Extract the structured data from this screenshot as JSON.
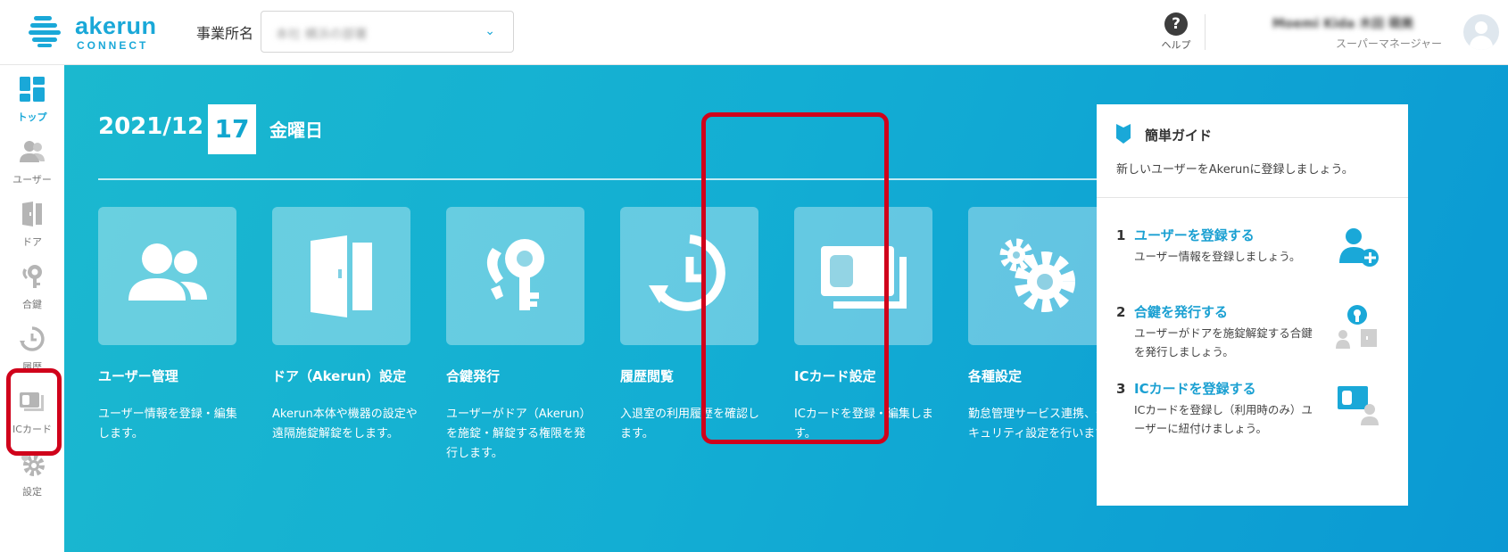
{
  "header": {
    "logo_word": "akerun",
    "logo_sub": "CONNECT",
    "office_label": "事業所名",
    "office_value": "本社 横浜の部署",
    "help_label": "ヘルプ",
    "user_name": "Moemi Kida 木田 萌美",
    "user_role": "スーパーマネージャー"
  },
  "sidebar": {
    "items": [
      {
        "label": "トップ",
        "icon": "dashboard-icon"
      },
      {
        "label": "ユーザー",
        "icon": "users-icon"
      },
      {
        "label": "ドア",
        "icon": "door-icon"
      },
      {
        "label": "合鍵",
        "icon": "key-icon"
      },
      {
        "label": "履歴",
        "icon": "history-icon"
      },
      {
        "label": "ICカード",
        "icon": "ic-card-icon"
      },
      {
        "label": "設定",
        "icon": "gear-icon"
      }
    ]
  },
  "main": {
    "date_ym": "2021/12",
    "date_day": "17",
    "date_dow": "金曜日",
    "cards": [
      {
        "title": "ユーザー管理",
        "desc": "ユーザー情報を登録・編集します。",
        "icon": "users-icon"
      },
      {
        "title": "ドア（Akerun）設定",
        "desc": "Akerun本体や機器の設定や遠隔施錠解錠をします。",
        "icon": "door-icon"
      },
      {
        "title": "合鍵発行",
        "desc": "ユーザーがドア（Akerun）を施錠・解錠する権限を発行します。",
        "icon": "key-icon"
      },
      {
        "title": "履歴閲覧",
        "desc": "入退室の利用履歴を確認します。",
        "icon": "history-icon"
      },
      {
        "title": "ICカード設定",
        "desc": "ICカードを登録・編集します。",
        "icon": "ic-card-icon"
      },
      {
        "title": "各種設定",
        "desc": "勤怠管理サービス連携、セキュリティ設定を行います。",
        "icon": "gear-icon"
      }
    ]
  },
  "guide": {
    "title": "簡単ガイド",
    "intro": "新しいユーザーをAkerunに登録しましょう。",
    "steps": [
      {
        "num": "1",
        "link": "ユーザーを登録する",
        "desc": "ユーザー情報を登録しましょう。",
        "icon": "add-user-icon"
      },
      {
        "num": "2",
        "link": "合鍵を発行する",
        "desc": "ユーザーがドアを施錠解錠する合鍵を発行しましょう。",
        "icon": "key-user-icon"
      },
      {
        "num": "3",
        "link": "ICカードを登録する",
        "desc": "ICカードを登録し（利用時のみ）ユーザーに紐付けましょう。",
        "icon": "card-user-icon"
      }
    ]
  },
  "colors": {
    "accent": "#1aa8d8",
    "highlight": "#d0021b",
    "main_bg": "#13aed3"
  }
}
